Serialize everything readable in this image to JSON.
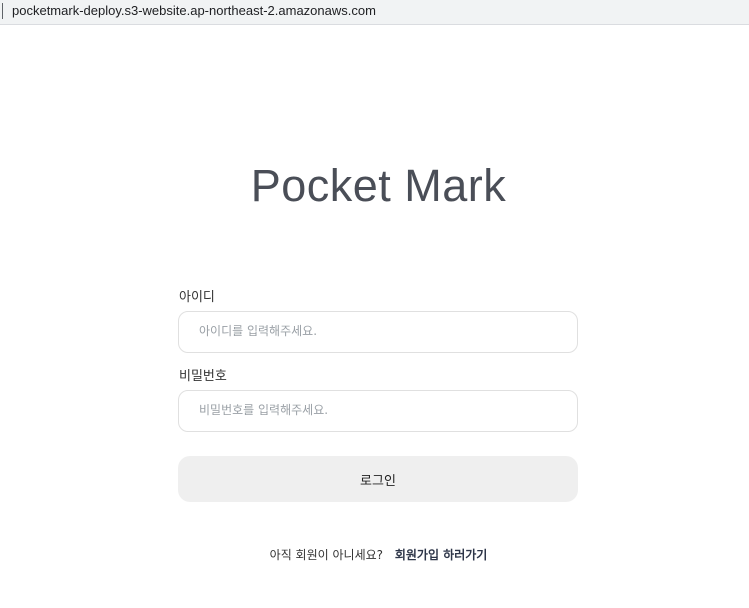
{
  "browser": {
    "url": "pocketmark-deploy.s3-website.ap-northeast-2.amazonaws.com"
  },
  "app": {
    "logo": "Pocket Mark"
  },
  "login_form": {
    "id_label": "아이디",
    "id_placeholder": "아이디를 입력해주세요.",
    "password_label": "비밀번호",
    "password_placeholder": "비밀번호를 입력해주세요.",
    "submit_label": "로그인"
  },
  "signup": {
    "prompt": "아직 회원이 아니세요?",
    "link_label": "회원가입 하러가기"
  }
}
